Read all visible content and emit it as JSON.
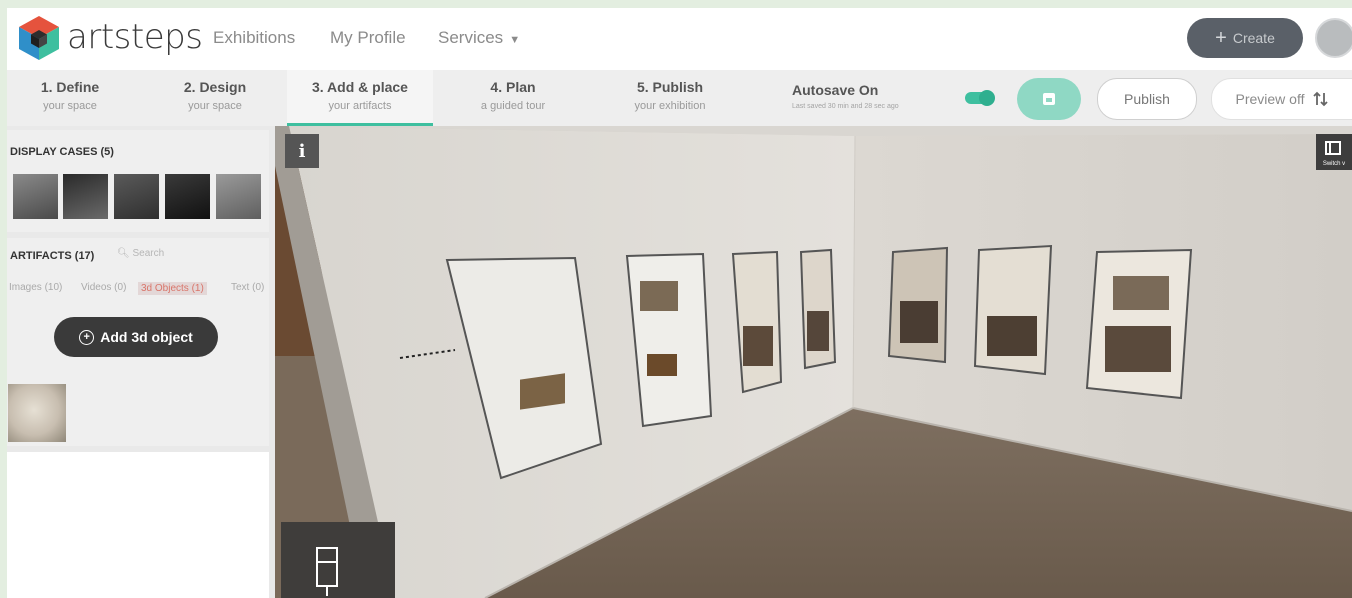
{
  "app": {
    "brand": "artsteps",
    "accent_color": "#3ebf9f"
  },
  "nav": {
    "exhibitions": "Exhibitions",
    "my_profile": "My Profile",
    "services": "Services",
    "create": "Create"
  },
  "steps": [
    {
      "title": "1. Define",
      "sub": "your space"
    },
    {
      "title": "2. Design",
      "sub": "your space"
    },
    {
      "title": "3. Add & place",
      "sub": "your artifacts",
      "active": true
    },
    {
      "title": "4. Plan",
      "sub": "a guided tour"
    },
    {
      "title": "5. Publish",
      "sub": "your exhibition"
    }
  ],
  "autosave": {
    "title": "Autosave On",
    "sub": "Last saved 30 min and 28 sec ago",
    "enabled": true
  },
  "actions": {
    "publish": "Publish",
    "preview": "Preview off"
  },
  "sidebar": {
    "display_cases_title": "DISPLAY CASES (5)",
    "artifacts_title": "ARTIFACTS (17)",
    "search_placeholder": "Search",
    "tabs": [
      {
        "label": "Images (10)"
      },
      {
        "label": "Videos (0)"
      },
      {
        "label": "3d Objects (1)",
        "active": true
      },
      {
        "label": "Text (0)"
      }
    ],
    "add_button": "Add 3d object"
  },
  "scene": {
    "info_label": "i",
    "switch_label": "Switch v"
  }
}
